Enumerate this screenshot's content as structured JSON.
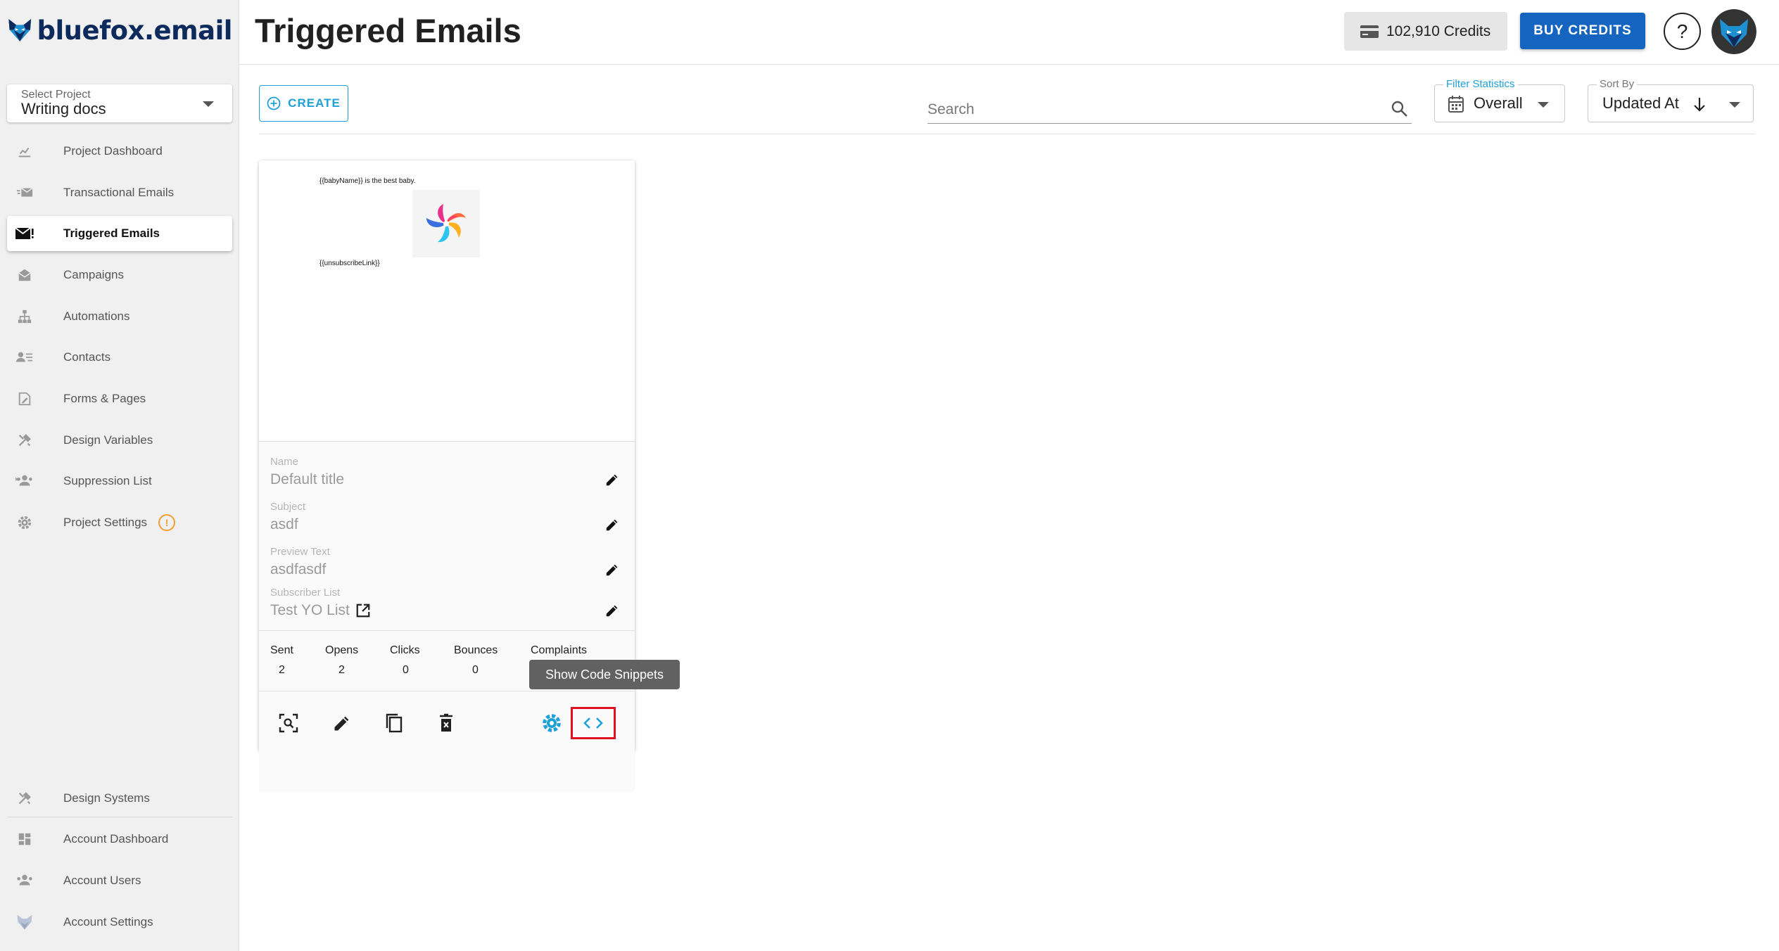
{
  "brand": {
    "name": "bluefox.email"
  },
  "project": {
    "label": "Select Project",
    "value": "Writing docs"
  },
  "nav": [
    {
      "label": "Project Dashboard",
      "icon": "chart-icon"
    },
    {
      "label": "Transactional Emails",
      "icon": "mail-fast-icon"
    },
    {
      "label": "Triggered Emails",
      "icon": "mail-alert-icon",
      "active": true
    },
    {
      "label": "Campaigns",
      "icon": "mailbox-icon"
    },
    {
      "label": "Automations",
      "icon": "sitemap-icon"
    },
    {
      "label": "Contacts",
      "icon": "contacts-icon"
    },
    {
      "label": "Forms & Pages",
      "icon": "form-icon"
    },
    {
      "label": "Design Variables",
      "icon": "tools-icon"
    },
    {
      "label": "Suppression List",
      "icon": "users-block-icon"
    },
    {
      "label": "Project Settings",
      "icon": "gear-icon",
      "badge": "!"
    }
  ],
  "nav_bottom": [
    {
      "label": "Design Systems",
      "icon": "tools-icon"
    },
    {
      "label": "Account Dashboard",
      "icon": "dashboard-icon"
    },
    {
      "label": "Account Users",
      "icon": "users-icon"
    },
    {
      "label": "Account Settings",
      "icon": "fox-icon"
    }
  ],
  "header": {
    "title": "Triggered Emails",
    "credits": "102,910 Credits",
    "buy_label": "BUY CREDITS",
    "help_label": "?"
  },
  "toolbar": {
    "create_label": "CREATE",
    "search_placeholder": "Search",
    "filter": {
      "label": "Filter Statistics",
      "value": "Overall"
    },
    "sort": {
      "label": "Sort By",
      "value": "Updated At"
    }
  },
  "card": {
    "preview": {
      "line1": "{{babyName}} is the best baby.",
      "line2": "{{unsubscribeLink}}"
    },
    "fields": [
      {
        "label": "Name",
        "value": "Default title"
      },
      {
        "label": "Subject",
        "value": "asdf"
      },
      {
        "label": "Preview Text",
        "value": "asdfasdf"
      },
      {
        "label": "Subscriber List",
        "value": "Test YO List"
      }
    ],
    "stats": [
      {
        "label": "Sent",
        "value": "2"
      },
      {
        "label": "Opens",
        "value": "2"
      },
      {
        "label": "Clicks",
        "value": "0"
      },
      {
        "label": "Bounces",
        "value": "0"
      },
      {
        "label": "Complaints",
        "value": ""
      }
    ]
  },
  "tooltip": "Show Code Snippets",
  "colors": {
    "accent": "#1ea0d8",
    "primary": "#1565c0",
    "highlight": "#e01020",
    "warning": "#f0a030"
  }
}
